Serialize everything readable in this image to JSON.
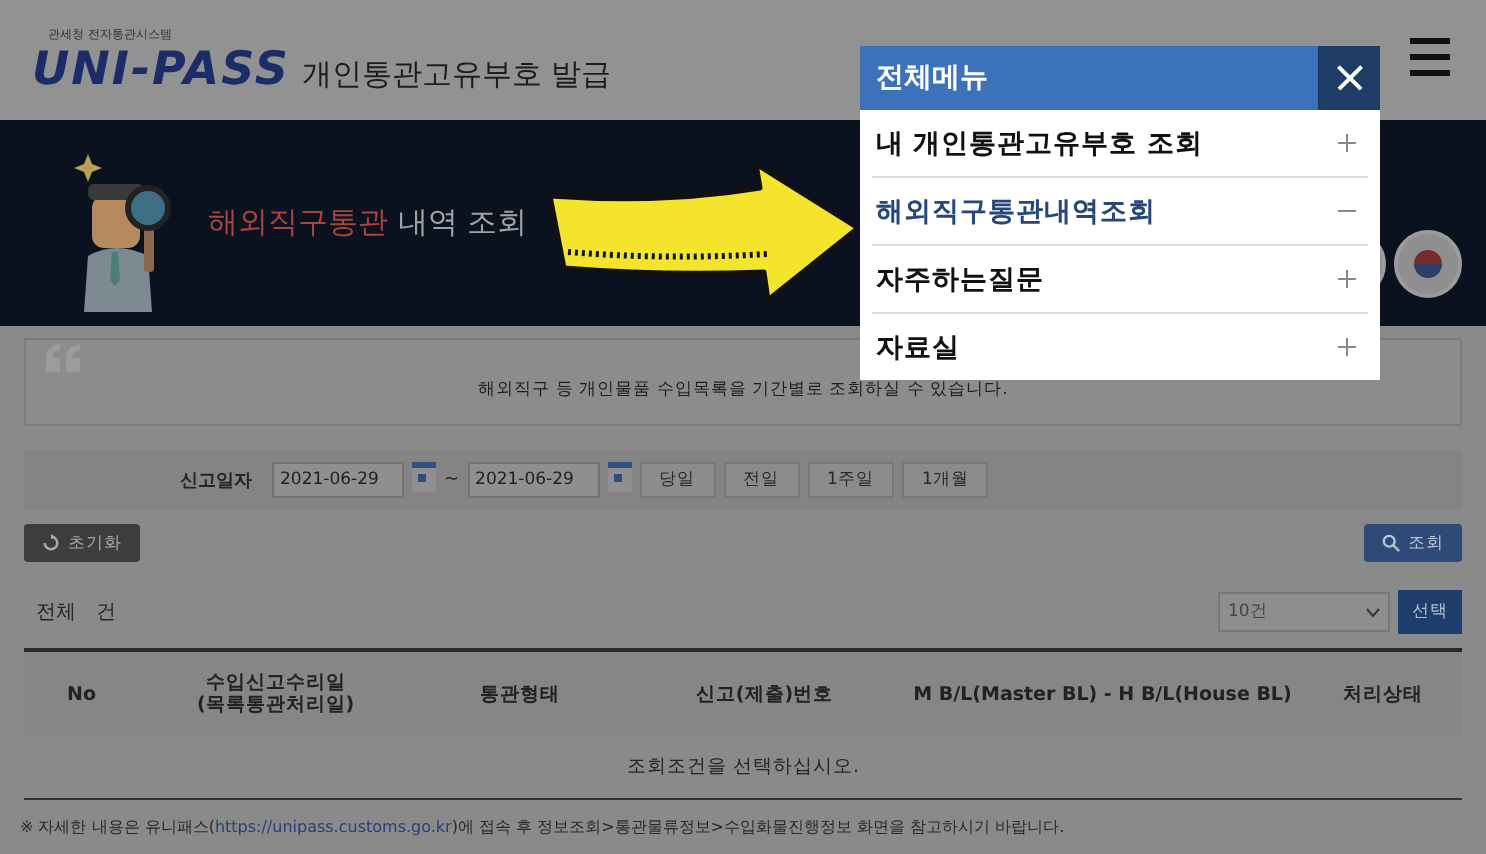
{
  "header": {
    "logo_caption": "관세청 전자통관시스템",
    "logo": "UNI-PASS",
    "title": "개인통관고유부호 발급"
  },
  "banner": {
    "highlight": "해외직구통관",
    "title": "내역 조회"
  },
  "intro": "해외직구 등 개인물품 수입목록을 기간별로 조회하실 수 있습니다.",
  "search": {
    "label": "신고일자",
    "date_from": "2021-06-29",
    "separator": "~",
    "date_to": "2021-06-29",
    "period_buttons": [
      "당일",
      "전일",
      "1주일",
      "1개월"
    ],
    "reset_button": "초기화",
    "search_button": "조회"
  },
  "results": {
    "count_label": "전체",
    "count_unit": "건",
    "page_size": "10건",
    "select_button": "선택"
  },
  "table": {
    "columns": [
      "No",
      "수입신고수리일\n(목록통관처리일)",
      "통관형태",
      "신고(제출)번호",
      "M B/L(Master BL) - H B/L(House BL)",
      "처리상태"
    ],
    "empty_message": "조회조건을 선택하십시오."
  },
  "note": {
    "before": "※ 자세한 내용은 유니패스(",
    "link": "https://unipass.customs.go.kr",
    "after": ")에 접속 후 정보조회>통관물류정보>수입화물진행정보 화면을 참고하시기 바랍니다."
  },
  "menu": {
    "title": "전체메뉴",
    "items": [
      {
        "label": "내 개인통관고유부호 조회",
        "expanded": false
      },
      {
        "label": "해외직구통관내역조회",
        "expanded": true
      },
      {
        "label": "자주하는질문",
        "expanded": false
      },
      {
        "label": "자료실",
        "expanded": false
      }
    ]
  }
}
